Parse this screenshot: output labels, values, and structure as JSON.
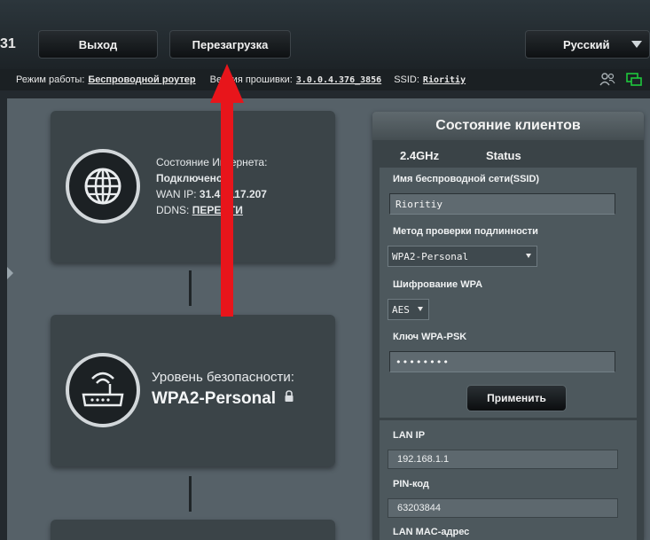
{
  "header": {
    "logo_fragment": "31",
    "logout_label": "Выход",
    "reboot_label": "Перезагрузка",
    "language_label": "Русский"
  },
  "infobar": {
    "mode_label": "Режим работы:",
    "mode_value": "Беспроводной роутер",
    "firmware_label": "Версия прошивки:",
    "firmware_value": "3.0.0.4.376_3856",
    "ssid_label": "SSID:",
    "ssid_value": "Rioritiy"
  },
  "internet_card": {
    "status_label": "Состояние Интернета:",
    "status_value": "Подключено",
    "wan_ip_label": "WAN IP:",
    "wan_ip_value": "31.4. .117.207",
    "ddns_label": "DDNS:",
    "ddns_value": "ПЕРЕЙТИ"
  },
  "security_card": {
    "label": "Уровень безопасности:",
    "value": "WPA2-Personal"
  },
  "client_panel": {
    "title": "Состояние клиентов",
    "tabs": [
      "2.4GHz",
      "Status"
    ],
    "ssid_field_label": "Имя беспроводной сети(SSID)",
    "ssid_field_value": "Rioritiy",
    "auth_label": "Метод проверки подлинности",
    "auth_value": "WPA2-Personal",
    "encryption_label": "Шифрование WPA",
    "encryption_value": "AES",
    "psk_label": "Ключ WPA-PSK",
    "psk_value": "••••••••",
    "apply_label": "Применить"
  },
  "lan_panel": {
    "lan_ip_label": "LAN IP",
    "lan_ip_value": "192.168.1.1",
    "pin_label": "PIN-код",
    "pin_value": "63203844",
    "mac_label": "LAN MAC-адрес"
  },
  "colors": {
    "annotation_arrow": "#e8151b",
    "panel_bg": "#3a4347",
    "status_green": "#1ec83c"
  }
}
